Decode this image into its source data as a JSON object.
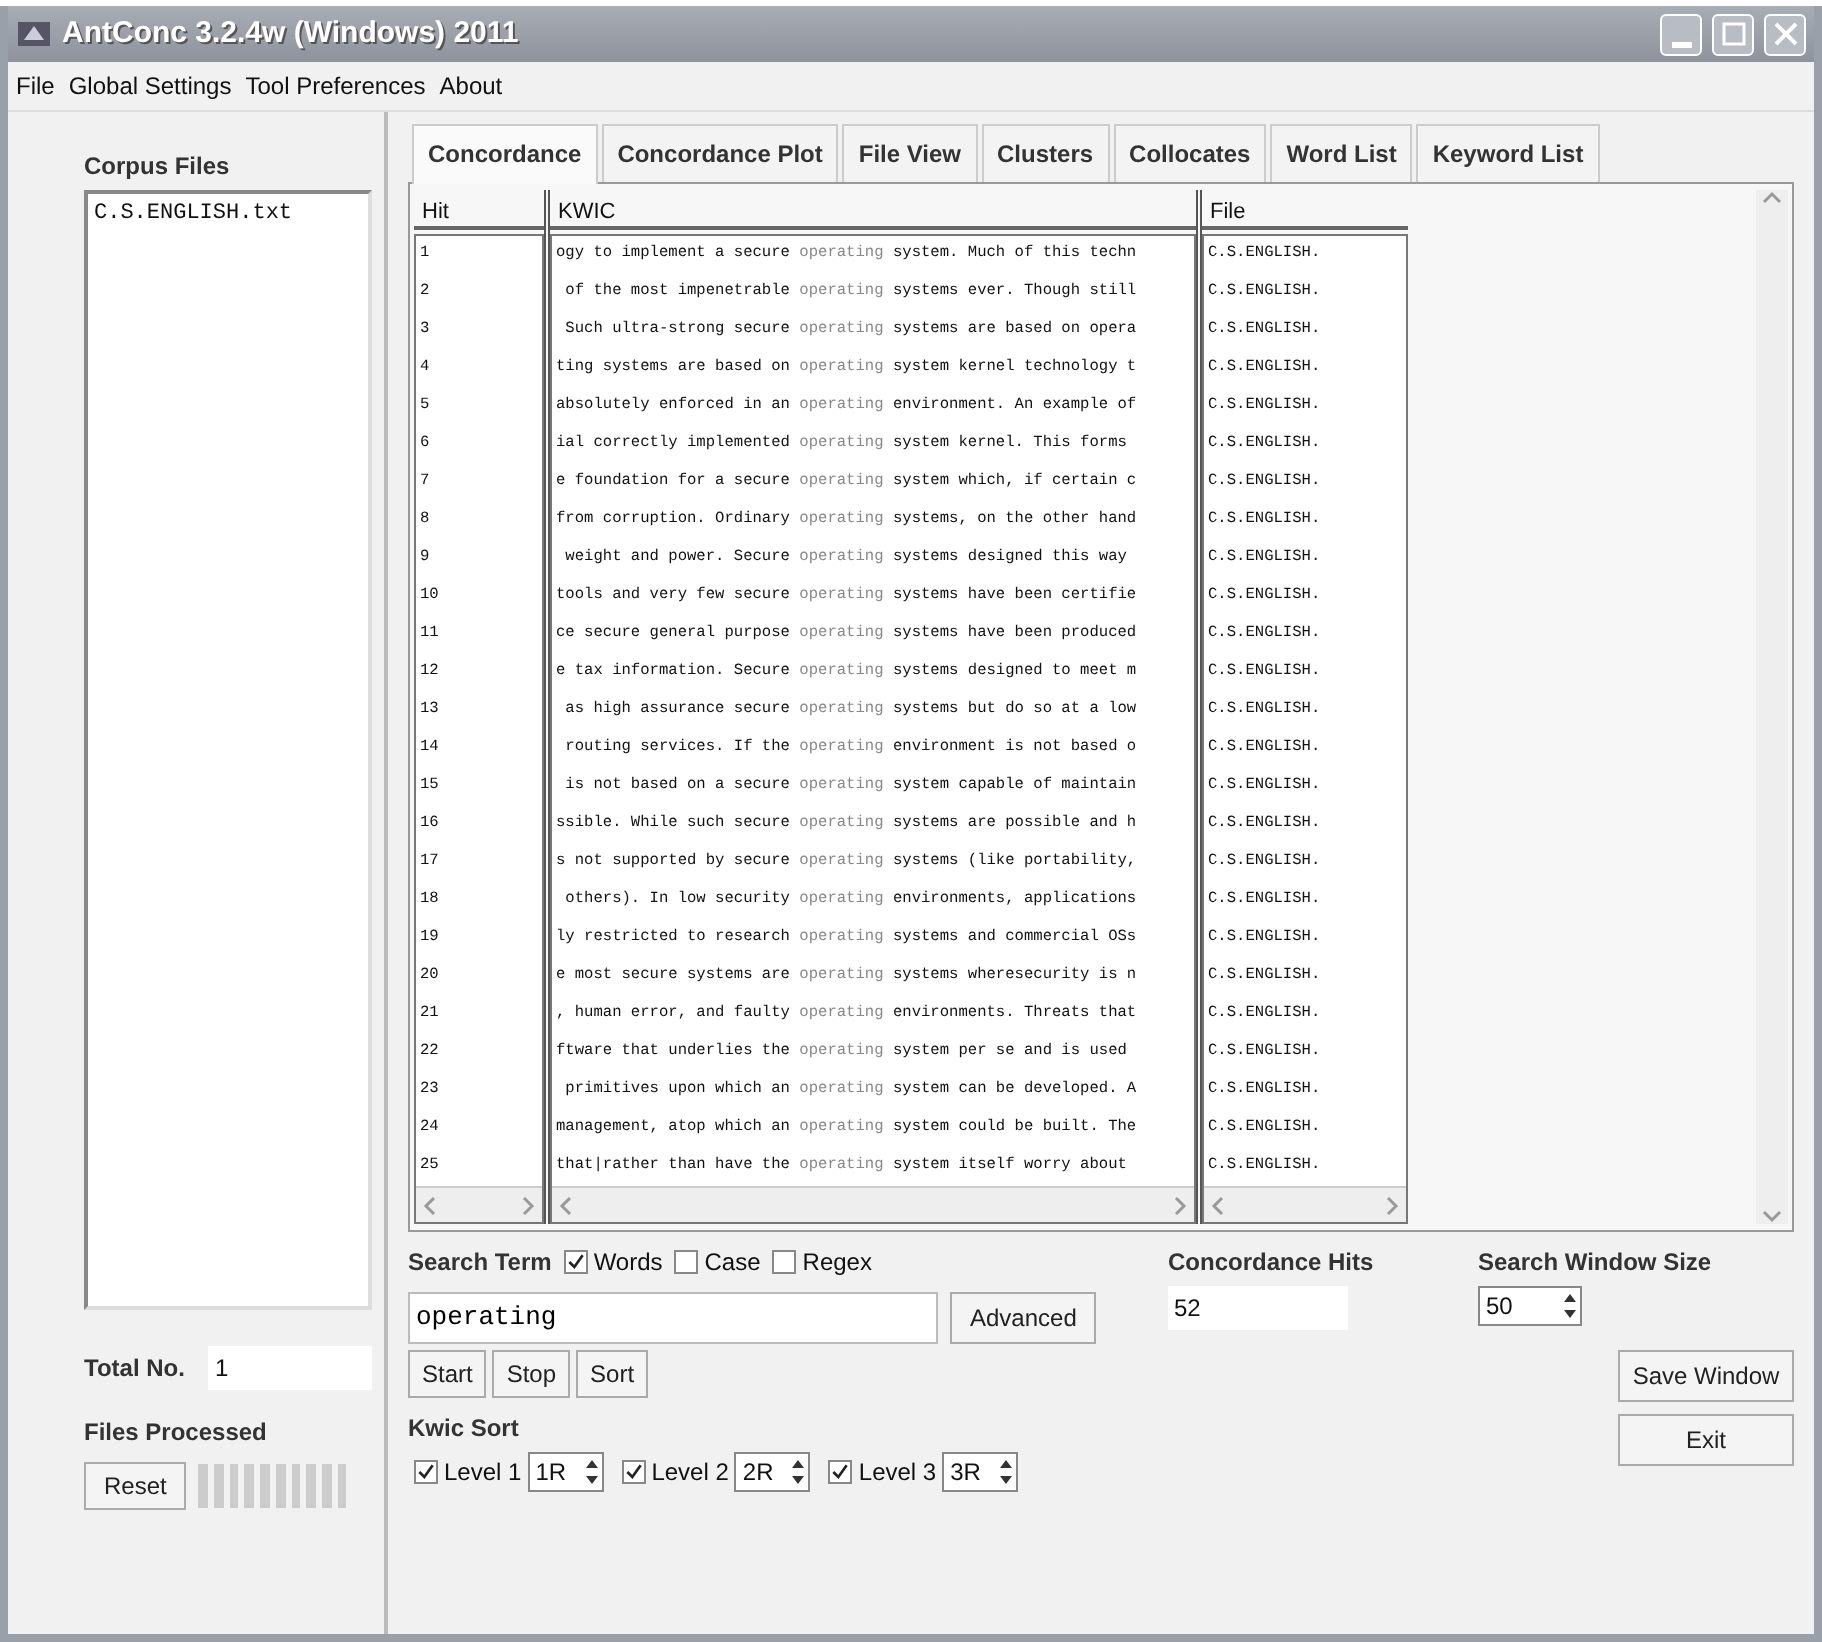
{
  "window": {
    "title": "AntConc 3.2.4w (Windows) 2011"
  },
  "menu": [
    "File",
    "Global Settings",
    "Tool Preferences",
    "About"
  ],
  "corpus_panel": {
    "label": "Corpus Files",
    "files": [
      "C.S.ENGLISH.txt"
    ],
    "total_label": "Total No.",
    "total_value": "1",
    "processed_label": "Files Processed",
    "reset_button": "Reset",
    "progress": {
      "level": 1
    }
  },
  "tabs": [
    {
      "label": "Concordance",
      "selected": true
    },
    {
      "label": "Concordance Plot",
      "selected": false
    },
    {
      "label": "File View",
      "selected": false
    },
    {
      "label": "Clusters",
      "selected": false
    },
    {
      "label": "Collocates",
      "selected": false
    },
    {
      "label": "Word List",
      "selected": false
    },
    {
      "label": "Keyword List",
      "selected": false
    }
  ],
  "table": {
    "columns": [
      "Hit",
      "KWIC",
      "File"
    ],
    "rows": [
      {
        "hit": "1",
        "left": "ogy to implement a secure",
        "keyword": "operating",
        "right": "system. Much of this techn",
        "file": "C.S.ENGLISH."
      },
      {
        "hit": "2",
        "left": " of the most impenetrable",
        "keyword": "operating",
        "right": "systems ever. Though still",
        "file": "C.S.ENGLISH."
      },
      {
        "hit": "3",
        "left": " Such ultra-strong secure",
        "keyword": "operating",
        "right": "systems are based on opera",
        "file": "C.S.ENGLISH."
      },
      {
        "hit": "4",
        "left": "ting systems are based on",
        "keyword": "operating",
        "right": "system kernel technology t",
        "file": "C.S.ENGLISH."
      },
      {
        "hit": "5",
        "left": "absolutely enforced in an",
        "keyword": "operating",
        "right": "environment. An example of",
        "file": "C.S.ENGLISH."
      },
      {
        "hit": "6",
        "left": "ial correctly implemented",
        "keyword": "operating",
        "right": "system kernel. This forms",
        "file": "C.S.ENGLISH."
      },
      {
        "hit": "7",
        "left": "e foundation for a secure",
        "keyword": "operating",
        "right": "system which, if certain c",
        "file": "C.S.ENGLISH."
      },
      {
        "hit": "8",
        "left": "from corruption. Ordinary",
        "keyword": "operating",
        "right": "systems, on the other hand",
        "file": "C.S.ENGLISH."
      },
      {
        "hit": "9",
        "left": " weight and power. Secure",
        "keyword": "operating",
        "right": "systems designed this way",
        "file": "C.S.ENGLISH."
      },
      {
        "hit": "10",
        "left": "tools and very few secure",
        "keyword": "operating",
        "right": "systems have been certifie",
        "file": "C.S.ENGLISH."
      },
      {
        "hit": "11",
        "left": "ce secure general purpose",
        "keyword": "operating",
        "right": "systems have been produced",
        "file": "C.S.ENGLISH."
      },
      {
        "hit": "12",
        "left": "e tax information. Secure",
        "keyword": "operating",
        "right": "systems designed to meet m",
        "file": "C.S.ENGLISH."
      },
      {
        "hit": "13",
        "left": " as high assurance secure",
        "keyword": "operating",
        "right": "systems but do so at a low",
        "file": "C.S.ENGLISH."
      },
      {
        "hit": "14",
        "left": " routing services. If the",
        "keyword": "operating",
        "right": "environment is not based o",
        "file": "C.S.ENGLISH."
      },
      {
        "hit": "15",
        "left": " is not based on a secure",
        "keyword": "operating",
        "right": "system capable of maintain",
        "file": "C.S.ENGLISH."
      },
      {
        "hit": "16",
        "left": "ssible. While such secure",
        "keyword": "operating",
        "right": "systems are possible and h",
        "file": "C.S.ENGLISH."
      },
      {
        "hit": "17",
        "left": "s not supported by secure",
        "keyword": "operating",
        "right": "systems (like portability,",
        "file": "C.S.ENGLISH."
      },
      {
        "hit": "18",
        "left": " others). In low security",
        "keyword": "operating",
        "right": "environments, applications",
        "file": "C.S.ENGLISH."
      },
      {
        "hit": "19",
        "left": "ly restricted to research",
        "keyword": "operating",
        "right": "systems and commercial OSs",
        "file": "C.S.ENGLISH."
      },
      {
        "hit": "20",
        "left": "e most secure systems are",
        "keyword": "operating",
        "right": "systems wheresecurity is n",
        "file": "C.S.ENGLISH."
      },
      {
        "hit": "21",
        "left": ", human error, and faulty",
        "keyword": "operating",
        "right": "environments. Threats that",
        "file": "C.S.ENGLISH."
      },
      {
        "hit": "22",
        "left": "ftware that underlies the",
        "keyword": "operating",
        "right": "system per se and is used",
        "file": "C.S.ENGLISH."
      },
      {
        "hit": "23",
        "left": " primitives upon which an",
        "keyword": "operating",
        "right": "system can be developed. A",
        "file": "C.S.ENGLISH."
      },
      {
        "hit": "24",
        "left": "management, atop which an",
        "keyword": "operating",
        "right": "system could be built. The",
        "file": "C.S.ENGLISH."
      },
      {
        "hit": "25",
        "left": "that|rather than have the",
        "keyword": "operating",
        "right": "system itself worry about",
        "file": "C.S.ENGLISH."
      }
    ]
  },
  "search": {
    "label": "Search Term",
    "options": [
      {
        "label": "Words",
        "checked": true
      },
      {
        "label": "Case",
        "checked": false
      },
      {
        "label": "Regex",
        "checked": false
      }
    ],
    "value": "operating",
    "advanced_button": "Advanced",
    "buttons": [
      "Start",
      "Stop",
      "Sort"
    ]
  },
  "hits": {
    "label": "Concordance Hits",
    "value": "52"
  },
  "window_size": {
    "label": "Search Window Size",
    "value": "50"
  },
  "kwic_sort": {
    "label": "Kwic Sort",
    "levels": [
      {
        "label": "Level 1",
        "checked": true,
        "value": "1R"
      },
      {
        "label": "Level 2",
        "checked": true,
        "value": "2R"
      },
      {
        "label": "Level 3",
        "checked": true,
        "value": "3R"
      }
    ]
  },
  "side_buttons": [
    "Save Window",
    "Exit"
  ]
}
